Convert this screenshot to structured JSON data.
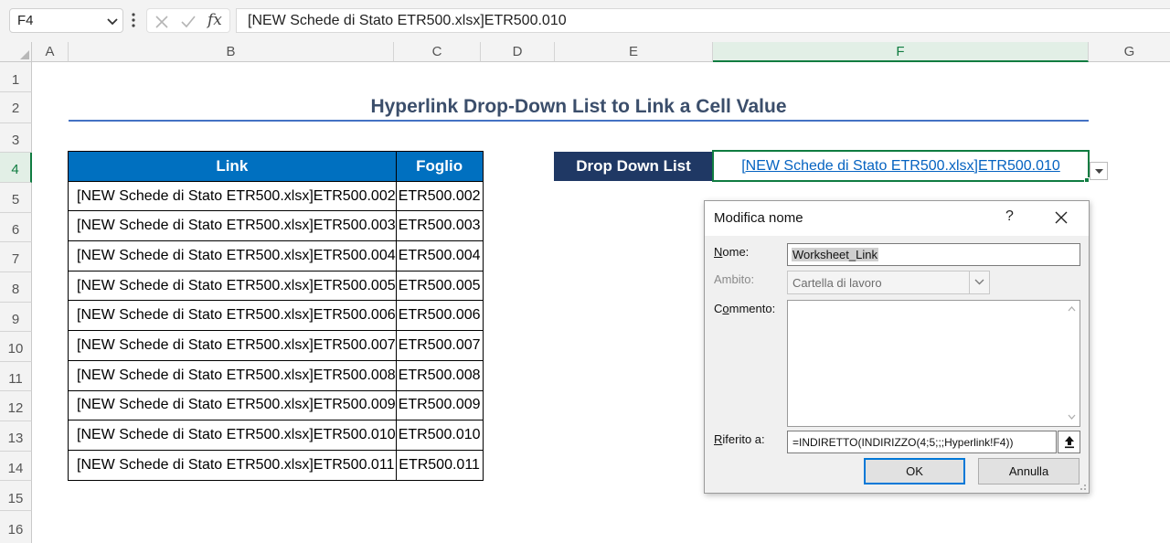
{
  "formula_bar": {
    "name_box": "F4",
    "fx_label": "fx",
    "formula": "[NEW Schede di Stato ETR500.xlsx]ETR500.010"
  },
  "columns": [
    "A",
    "B",
    "C",
    "D",
    "E",
    "F",
    "G"
  ],
  "rows": [
    "1",
    "2",
    "3",
    "4",
    "5",
    "6",
    "7",
    "8",
    "9",
    "10",
    "11",
    "12",
    "13",
    "14",
    "15",
    "16"
  ],
  "sheet": {
    "title": "Hyperlink Drop-Down List to Link a Cell Value",
    "table_headers": [
      "Link",
      "Foglio"
    ],
    "table_rows": [
      [
        "[NEW Schede di Stato ETR500.xlsx]ETR500.002",
        "ETR500.002"
      ],
      [
        "[NEW Schede di Stato ETR500.xlsx]ETR500.003",
        "ETR500.003"
      ],
      [
        "[NEW Schede di Stato ETR500.xlsx]ETR500.004",
        "ETR500.004"
      ],
      [
        "[NEW Schede di Stato ETR500.xlsx]ETR500.005",
        "ETR500.005"
      ],
      [
        "[NEW Schede di Stato ETR500.xlsx]ETR500.006",
        "ETR500.006"
      ],
      [
        "[NEW Schede di Stato ETR500.xlsx]ETR500.007",
        "ETR500.007"
      ],
      [
        "[NEW Schede di Stato ETR500.xlsx]ETR500.008",
        "ETR500.008"
      ],
      [
        "[NEW Schede di Stato ETR500.xlsx]ETR500.009",
        "ETR500.009"
      ],
      [
        "[NEW Schede di Stato ETR500.xlsx]ETR500.010",
        "ETR500.010"
      ],
      [
        "[NEW Schede di Stato ETR500.xlsx]ETR500.011",
        "ETR500.011"
      ]
    ],
    "dropdown_label": "Drop Down List",
    "dropdown_value": "[NEW Schede di Stato ETR500.xlsx]ETR500.010"
  },
  "dialog": {
    "title": "Modifica nome",
    "help": "?",
    "nome_label_u": "N",
    "nome_label_rest": "ome:",
    "nome_value": "Worksheet_Link",
    "ambito_label": "Ambito:",
    "ambito_value": "Cartella di lavoro",
    "commento_label_pre": "C",
    "commento_label_u": "o",
    "commento_label_rest": "mmento:",
    "riferito_label_u": "R",
    "riferito_label_rest": "iferito a:",
    "riferito_value": "=INDIRETTO(INDIRIZZO(4;5;;;Hyperlink!F4))",
    "ok_label": "OK",
    "cancel_label": "Annulla"
  },
  "colors": {
    "accent_green": "#107c41",
    "table_header": "#0070c0",
    "dropdown_label_bg": "#1f3864",
    "link_blue": "#0563c1",
    "title_text": "#3b4e6b"
  }
}
